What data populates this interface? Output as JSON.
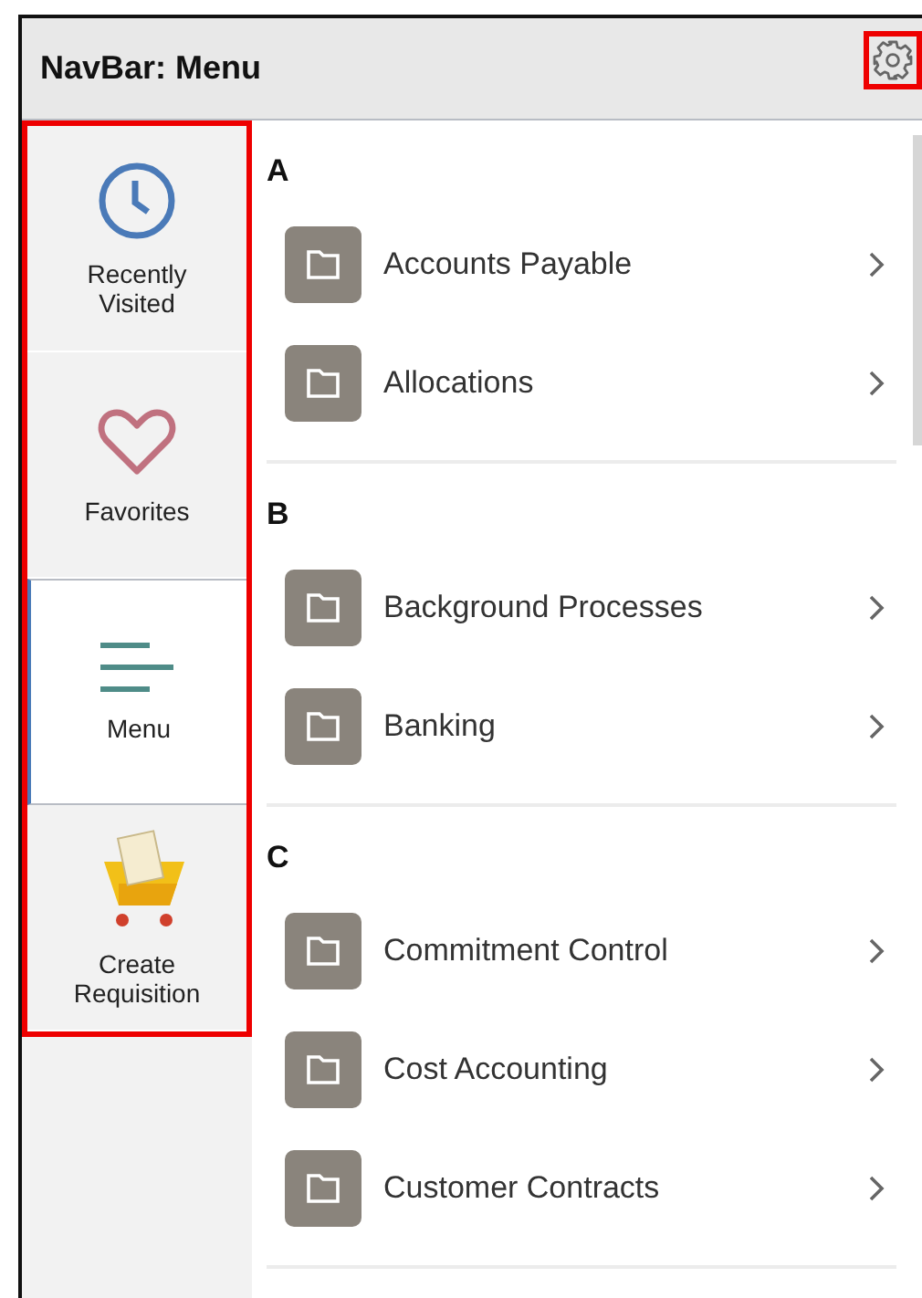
{
  "header": {
    "title": "NavBar: Menu"
  },
  "sidebar": {
    "items": [
      {
        "label": "Recently Visited",
        "kind": "clock",
        "selected": false
      },
      {
        "label": "Favorites",
        "kind": "heart",
        "selected": false
      },
      {
        "label": "Menu",
        "kind": "menu",
        "selected": true
      },
      {
        "label": "Create Requisition",
        "kind": "cart",
        "selected": false
      }
    ]
  },
  "sections": [
    {
      "letter": "A",
      "items": [
        {
          "label": "Accounts Payable"
        },
        {
          "label": "Allocations"
        }
      ]
    },
    {
      "letter": "B",
      "items": [
        {
          "label": "Background Processes"
        },
        {
          "label": "Banking"
        }
      ]
    },
    {
      "letter": "C",
      "items": [
        {
          "label": "Commitment Control"
        },
        {
          "label": "Cost Accounting"
        },
        {
          "label": "Customer Contracts"
        }
      ]
    }
  ]
}
